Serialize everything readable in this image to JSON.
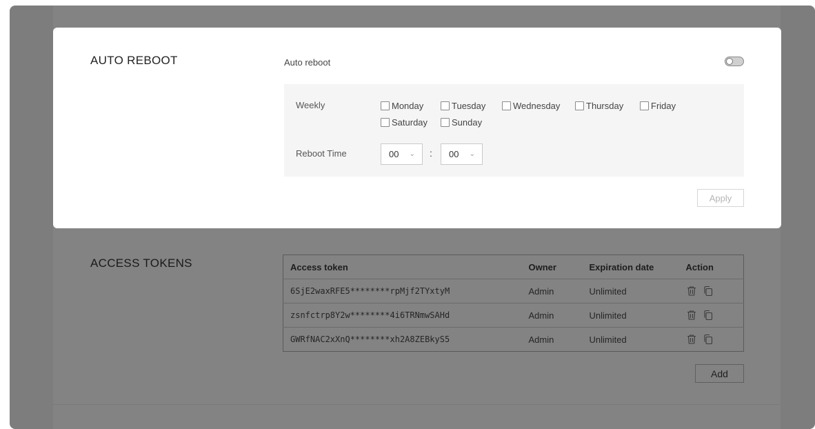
{
  "auto_reboot": {
    "section_title": "AUTO REBOOT",
    "toggle_label": "Auto reboot",
    "toggle_on": false,
    "weekly_label": "Weekly",
    "days": [
      "Monday",
      "Tuesday",
      "Wednesday",
      "Thursday",
      "Friday",
      "Saturday",
      "Sunday"
    ],
    "reboot_time_label": "Reboot Time",
    "hour_value": "00",
    "minute_value": "00",
    "time_separator": ":",
    "apply_label": "Apply"
  },
  "access_tokens": {
    "section_title": "ACCESS TOKENS",
    "columns": [
      "Access token",
      "Owner",
      "Expiration date",
      "Action"
    ],
    "rows": [
      {
        "token": "6SjE2waxRFE5********rpMjf2TYxtyM",
        "owner": "Admin",
        "expiration": "Unlimited"
      },
      {
        "token": "zsnfctrp8Y2w********4i6TRNmwSAHd",
        "owner": "Admin",
        "expiration": "Unlimited"
      },
      {
        "token": "GWRfNAC2xXnQ********xh2A8ZEBkyS5",
        "owner": "Admin",
        "expiration": "Unlimited"
      }
    ],
    "add_label": "Add"
  },
  "icons": {
    "delete": "trash-icon",
    "copy": "copy-icon",
    "dropdown": "chevron-down-icon"
  },
  "colors": {
    "overlay": "#7d7d7d",
    "card_bg": "#ffffff",
    "schedule_bg": "#f5f5f5"
  }
}
